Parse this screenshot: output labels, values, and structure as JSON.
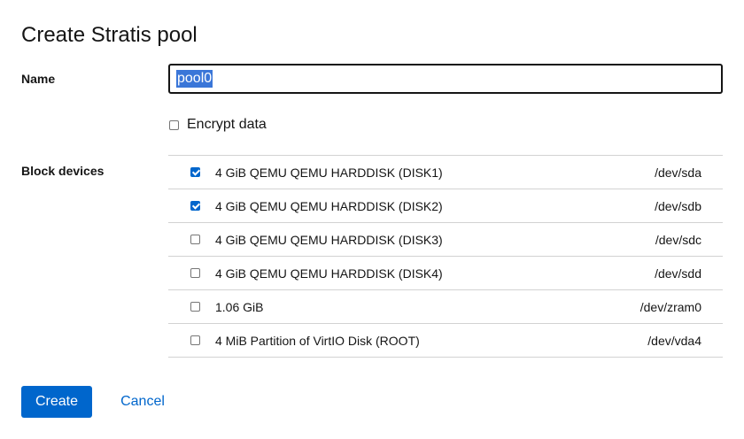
{
  "dialog": {
    "title": "Create Stratis pool"
  },
  "form": {
    "name_label": "Name",
    "name_value": "pool0",
    "encrypt_label": "Encrypt data",
    "encrypt_checked": false,
    "block_devices_label": "Block devices"
  },
  "devices": [
    {
      "description": "4 GiB QEMU QEMU HARDDISK (DISK1)",
      "path": "/dev/sda",
      "checked": true
    },
    {
      "description": "4 GiB QEMU QEMU HARDDISK (DISK2)",
      "path": "/dev/sdb",
      "checked": true
    },
    {
      "description": "4 GiB QEMU QEMU HARDDISK (DISK3)",
      "path": "/dev/sdc",
      "checked": false
    },
    {
      "description": "4 GiB QEMU QEMU HARDDISK (DISK4)",
      "path": "/dev/sdd",
      "checked": false
    },
    {
      "description": "1.06 GiB",
      "path": "/dev/zram0",
      "checked": false
    },
    {
      "description": "4 MiB Partition of VirtIO Disk (ROOT)",
      "path": "/dev/vda4",
      "checked": false
    }
  ],
  "actions": {
    "create_label": "Create",
    "cancel_label": "Cancel"
  },
  "colors": {
    "primary": "#0066cc",
    "selection": "#3a76d8",
    "border": "#d2d2d2"
  }
}
